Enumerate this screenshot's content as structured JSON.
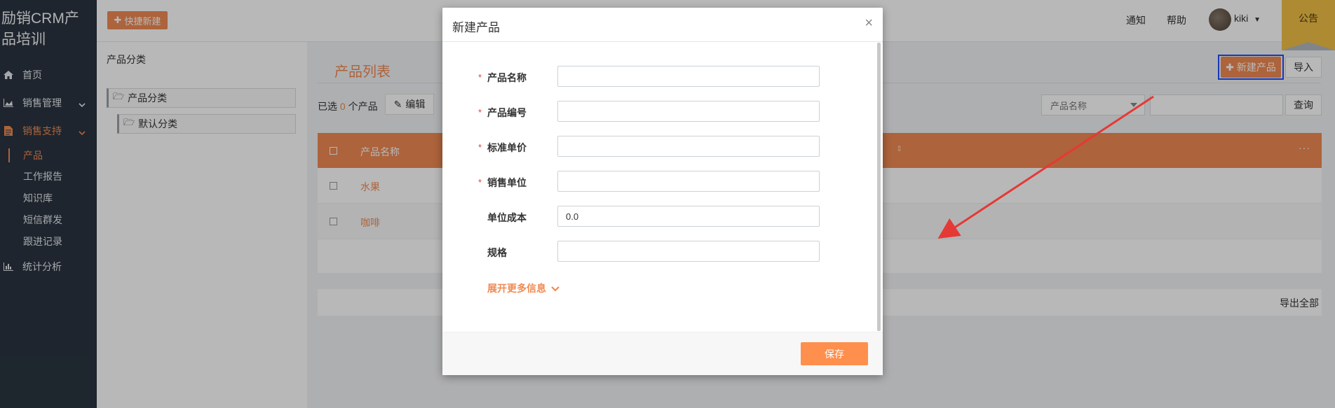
{
  "app": {
    "logo": "励销CRM产品培训"
  },
  "sidebar": {
    "items": [
      {
        "label": "首页"
      },
      {
        "label": "销售管理"
      },
      {
        "label": "销售支持"
      },
      {
        "label": "统计分析"
      }
    ],
    "sub_items": [
      {
        "label": "产品"
      },
      {
        "label": "工作报告"
      },
      {
        "label": "知识库"
      },
      {
        "label": "短信群发"
      },
      {
        "label": "跟进记录"
      }
    ]
  },
  "header": {
    "quick_new": "快捷新建",
    "notify": "通知",
    "help": "帮助",
    "user": "kiki",
    "notice": "公告"
  },
  "category": {
    "title": "产品分类",
    "root": "产品分类",
    "child": "默认分类"
  },
  "main": {
    "title": "产品列表",
    "new_product": "新建产品",
    "import": "导入",
    "selected_prefix": "已选",
    "selected_count": "0",
    "selected_suffix": "个产品",
    "edit": "编辑",
    "filter_field": "产品名称",
    "query": "查询",
    "column_name": "产品名称",
    "more": "···",
    "rows": [
      {
        "name": "水果"
      },
      {
        "name": "咖啡"
      }
    ],
    "export_all": "导出全部"
  },
  "modal": {
    "title": "新建产品",
    "close": "×",
    "fields": [
      {
        "label": "产品名称",
        "required": true,
        "value": ""
      },
      {
        "label": "产品编号",
        "required": true,
        "value": ""
      },
      {
        "label": "标准单价",
        "required": true,
        "value": ""
      },
      {
        "label": "销售单位",
        "required": true,
        "value": ""
      },
      {
        "label": "单位成本",
        "required": false,
        "value": "0.0"
      },
      {
        "label": "规格",
        "required": false,
        "value": ""
      }
    ],
    "required_mark": "*",
    "expand": "展开更多信息",
    "save": "保存"
  },
  "colors": {
    "accent": "#f08a53",
    "sidebar_bg": "#2a3440",
    "highlight_border": "#1f4fff",
    "annotation_arrow": "#e53935",
    "notice_bg": "#f2c047"
  }
}
